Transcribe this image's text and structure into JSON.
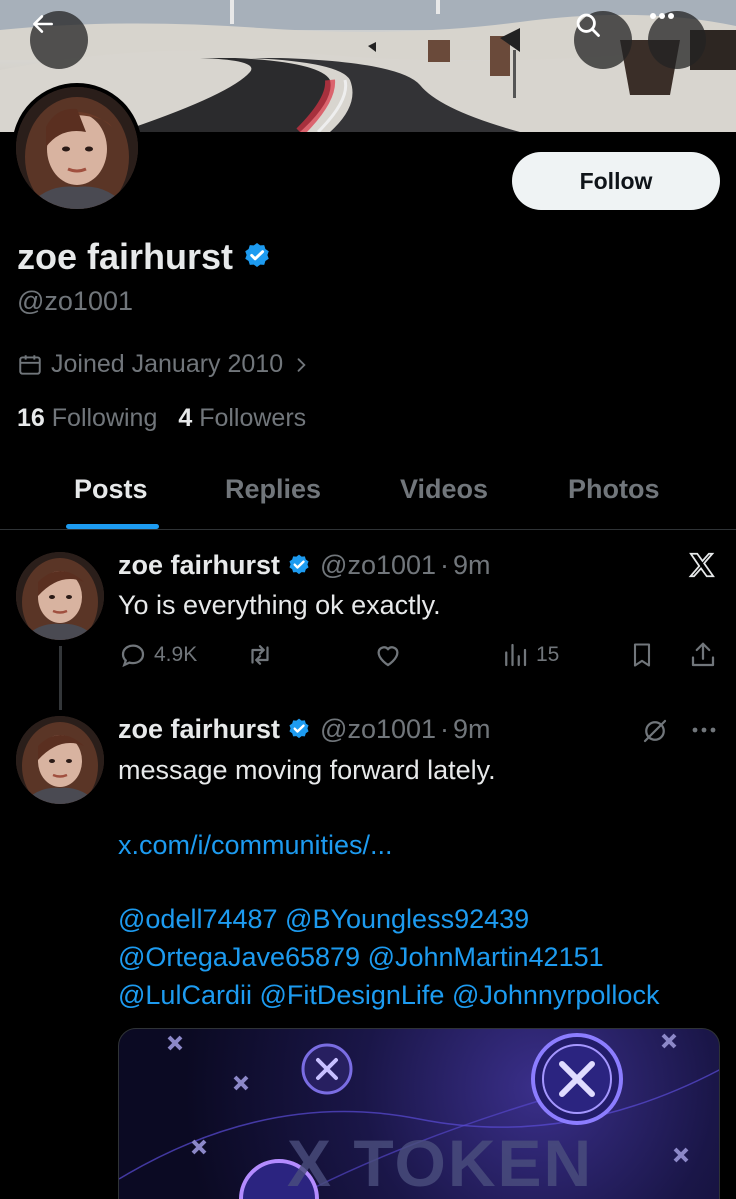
{
  "profile": {
    "display_name": "zoe fairhurst",
    "handle": "@zo1001",
    "joined": "Joined January 2010",
    "following_count": "16",
    "following_label": "Following",
    "followers_count": "4",
    "followers_label": "Followers",
    "follow_label": "Follow"
  },
  "tabs": [
    {
      "label": "Posts",
      "active": true
    },
    {
      "label": "Replies",
      "active": false
    },
    {
      "label": "Videos",
      "active": false
    },
    {
      "label": "Photos",
      "active": false
    }
  ],
  "posts": [
    {
      "name": "zoe fairhurst",
      "handle": "@zo1001",
      "time": "9m",
      "text": "Yo is everything ok exactly.",
      "replies": "4.9K",
      "views": "15"
    },
    {
      "name": "zoe fairhurst",
      "handle": "@zo1001",
      "time": "9m",
      "text": "message moving forward lately.",
      "link": "x.com/i/communities/...",
      "mentions_line1": "@odell74487 @BYoungless92439",
      "mentions_line2": "@OrtegaJave65879 @JohnMartin42151",
      "mentions_line3": "@LulCardii @FitDesignLife @Johnnyrpollock",
      "card_text": "X TOKEN"
    }
  ],
  "colors": {
    "accent": "#1d9bf0",
    "background": "#000000",
    "secondary_text": "#71767b",
    "primary_text": "#e7e9ea"
  },
  "icons": [
    "back-arrow-icon",
    "search-icon",
    "more-icon",
    "verified-badge-icon",
    "calendar-icon",
    "chevron-right-icon",
    "x-logo-icon",
    "reply-icon",
    "repost-icon",
    "like-icon",
    "views-icon",
    "bookmark-icon",
    "share-icon",
    "grok-icon"
  ]
}
